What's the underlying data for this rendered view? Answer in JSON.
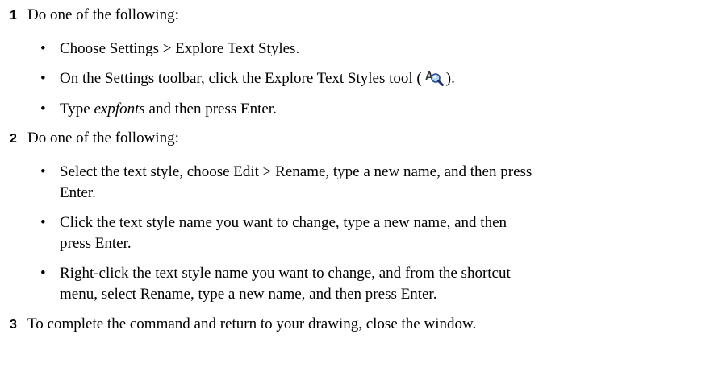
{
  "steps": [
    {
      "number": "1",
      "text": "Do one of the following:",
      "bullets": [
        {
          "text": "Choose Settings > Explore Text Styles."
        },
        {
          "before": "On the Settings toolbar, click the Explore Text Styles tool (",
          "icon": "explore-text-styles-icon",
          "after": ")."
        },
        {
          "italic": "expfonts",
          "after": " and then press Enter.",
          "before": "Type "
        }
      ]
    },
    {
      "number": "2",
      "text": "Do one of the following:",
      "bullets": [
        {
          "text": "Select the text style, choose Edit > Rename, type a new name, and then press Enter."
        },
        {
          "text": "Click the text style name you want to change, type a new name, and then press Enter."
        },
        {
          "text": "Right-click the text style name you want to change, and from the shortcut menu, select Rename, type a new name, and then press Enter."
        }
      ]
    },
    {
      "number": "3",
      "text": "To complete the command and return to your drawing, close the window."
    }
  ],
  "bullet_glyph": "•"
}
